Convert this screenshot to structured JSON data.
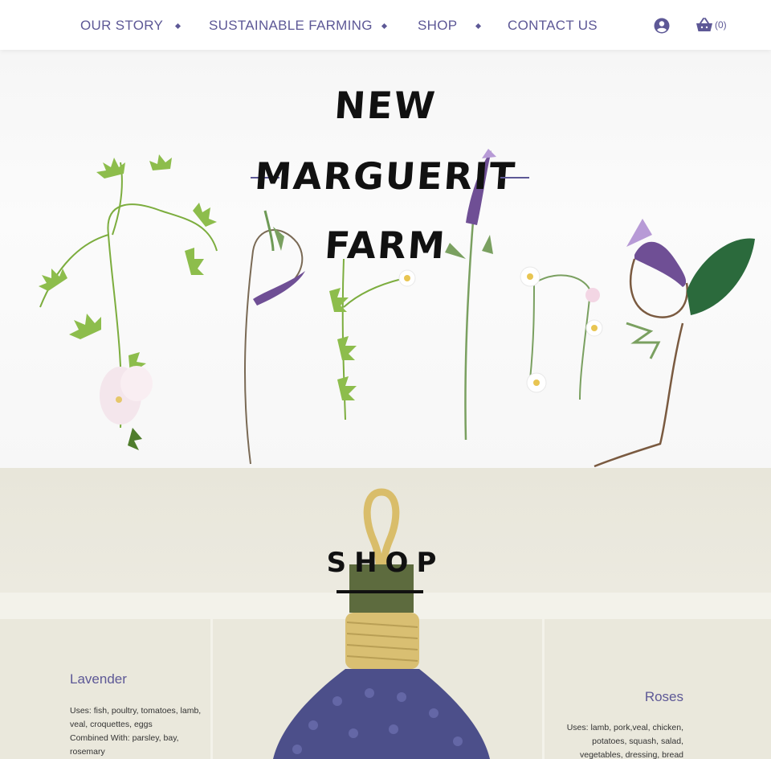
{
  "nav": {
    "items": [
      {
        "label": "OUR STORY"
      },
      {
        "label": "SUSTAINABLE FARMING"
      },
      {
        "label": "SHOP"
      },
      {
        "label": "CONTACT US"
      }
    ],
    "cart_count": "(0)",
    "accent_color": "#5d5896"
  },
  "hero": {
    "title_line1": "NEW",
    "title_line2": "MARGUERIT",
    "title_line3": "FARM"
  },
  "shop": {
    "title": "SHOP",
    "left_item": {
      "name": "Lavender",
      "uses": "Uses: fish, poultry, tomatoes, lamb,",
      "uses2": "veal, croquettes, eggs",
      "combined": "Combined With: parsley, bay,",
      "combined2": "rosemary"
    },
    "right_item": {
      "name": "Roses",
      "uses": "Uses: lamb, pork,veal, chicken,",
      "uses2": "potatoes,  squash, salad,",
      "uses3": "vegetables, dressing, bread"
    }
  }
}
